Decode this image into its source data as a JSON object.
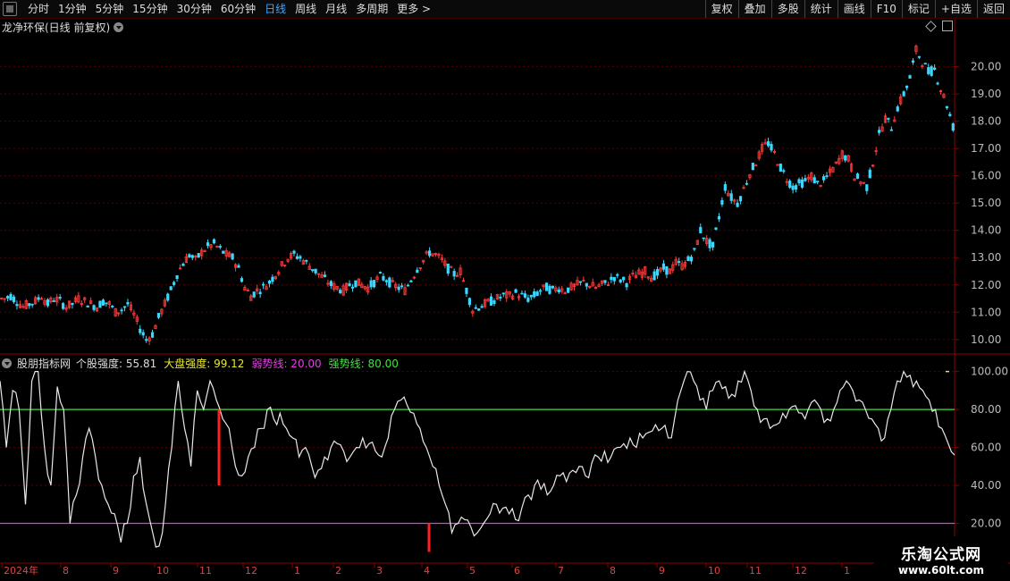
{
  "toolbar": {
    "periods": [
      "分时",
      "1分钟",
      "5分钟",
      "15分钟",
      "30分钟",
      "60分钟",
      "日线",
      "周线",
      "月线",
      "多周期",
      "更多 >"
    ],
    "active_period": "日线",
    "right_buttons": [
      "复权",
      "叠加",
      "多股",
      "统计",
      "画线",
      "F10",
      "标记",
      "+自选",
      "返回"
    ]
  },
  "chart_header": {
    "title": "龙净环保(日线 前复权)"
  },
  "indicator": {
    "name": "股朋指标网",
    "items": [
      {
        "label": "个股强度:",
        "value": "55.81",
        "color": "#dddddd"
      },
      {
        "label": "大盘强度:",
        "value": "99.12",
        "color": "#e8e83a"
      },
      {
        "label": "弱势线:",
        "value": "20.00",
        "color": "#e040e0"
      },
      {
        "label": "强势线:",
        "value": "80.00",
        "color": "#40e040"
      }
    ]
  },
  "x_axis": {
    "labels": [
      "2024年",
      "8",
      "9",
      "10",
      "11",
      "12",
      "1",
      "2",
      "3",
      "4",
      "5",
      "6",
      "7",
      "8",
      "9",
      "10",
      "11",
      "12",
      "1"
    ]
  },
  "watermark": {
    "line1": "乐淘公式网",
    "line2": "www.60lt.com"
  },
  "colors": {
    "up": "#ff3b3b",
    "down": "#3ad8ff",
    "grid": "#5a0000",
    "axis": "#8b0000"
  },
  "chart_data": [
    {
      "type": "candlestick",
      "title": "龙净环保(日线 前复权)",
      "y_ticks": [
        10.0,
        11.0,
        12.0,
        13.0,
        14.0,
        15.0,
        16.0,
        17.0,
        18.0,
        19.0,
        20.0
      ],
      "ylim": [
        9.6,
        21.2
      ],
      "close_trend": [
        11.5,
        11.6,
        11.4,
        11.2,
        11.3,
        11.4,
        11.6,
        11.3,
        11.5,
        11.4,
        11.2,
        11.3,
        11.5,
        11.4,
        11.3,
        11.2,
        11.4,
        11.3,
        11.0,
        11.1,
        11.3,
        10.9,
        10.4,
        10.0,
        10.2,
        10.8,
        11.3,
        11.8,
        12.4,
        12.8,
        13.1,
        12.9,
        13.2,
        13.4,
        13.5,
        13.3,
        13.1,
        13.0,
        12.6,
        11.9,
        11.6,
        11.8,
        11.9,
        12.1,
        12.4,
        12.7,
        13.0,
        13.1,
        13.0,
        12.8,
        12.6,
        12.4,
        12.2,
        12.0,
        11.9,
        11.8,
        12.0,
        12.1,
        12.0,
        11.9,
        12.1,
        12.3,
        12.2,
        12.0,
        11.9,
        11.8,
        12.2,
        12.6,
        12.9,
        13.2,
        13.1,
        12.9,
        12.6,
        12.4,
        12.5,
        11.8,
        11.1,
        11.2,
        11.3,
        11.4,
        11.5,
        11.6,
        11.6,
        11.7,
        11.6,
        11.5,
        11.6,
        11.8,
        11.9,
        11.8,
        11.9,
        11.8,
        11.9,
        12.0,
        12.1,
        12.0,
        11.9,
        12.0,
        12.1,
        12.3,
        12.2,
        12.1,
        12.3,
        12.4,
        12.5,
        12.3,
        12.4,
        12.6,
        12.5,
        12.8,
        12.7,
        12.9,
        13.2,
        14.0,
        13.6,
        13.4,
        14.5,
        15.6,
        15.2,
        15.0,
        15.5,
        16.1,
        16.5,
        17.0,
        17.2,
        16.8,
        16.3,
        15.9,
        15.6,
        15.7,
        15.8,
        16.0,
        15.7,
        15.8,
        16.1,
        16.4,
        16.8,
        16.6,
        16.0,
        15.8,
        15.6,
        16.5,
        17.5,
        18.1,
        17.8,
        18.5,
        19.0,
        19.6,
        20.6,
        20.2,
        19.8,
        19.9,
        19.2,
        18.6,
        17.8
      ]
    },
    {
      "type": "line",
      "title": "股朋指标网",
      "y_ticks": [
        20.0,
        40.0,
        60.0,
        80.0,
        100.0
      ],
      "ylim": [
        0,
        105
      ],
      "series": [
        {
          "name": "个股强度",
          "last": 55.81
        },
        {
          "name": "弱势线",
          "value": 20.0
        },
        {
          "name": "强势线",
          "value": 80.0
        }
      ],
      "strength": [
        95,
        60,
        90,
        80,
        30,
        95,
        100,
        60,
        40,
        92,
        80,
        20,
        35,
        55,
        70,
        55,
        40,
        30,
        25,
        10,
        20,
        45,
        55,
        30,
        15,
        8,
        30,
        60,
        95,
        70,
        50,
        90,
        80,
        95,
        85,
        75,
        70,
        50,
        45,
        55,
        60,
        70,
        80,
        75,
        78,
        70,
        65,
        55,
        60,
        50,
        48,
        55,
        60,
        62,
        58,
        55,
        60,
        65,
        62,
        58,
        55,
        65,
        80,
        85,
        82,
        78,
        70,
        60,
        50,
        40,
        30,
        15,
        20,
        22,
        18,
        15,
        20,
        25,
        30,
        28,
        25,
        22,
        28,
        35,
        40,
        38,
        35,
        40,
        45,
        42,
        48,
        50,
        45,
        52,
        55,
        58,
        55,
        60,
        62,
        65,
        60,
        65,
        68,
        72,
        70,
        65,
        75,
        90,
        100,
        95,
        85,
        80,
        90,
        95,
        92,
        88,
        95,
        100,
        90,
        80,
        75,
        70,
        72,
        78,
        80,
        82,
        78,
        80,
        85,
        80,
        75,
        80,
        90,
        95,
        90,
        85,
        80,
        75,
        70,
        65,
        80,
        95,
        100,
        98,
        95,
        90,
        85,
        80,
        70,
        62,
        56
      ],
      "signals": [
        {
          "x_label": "11",
          "from": 40,
          "to": 80
        },
        {
          "x_label": "4",
          "from": 5,
          "to": 20
        }
      ]
    }
  ]
}
